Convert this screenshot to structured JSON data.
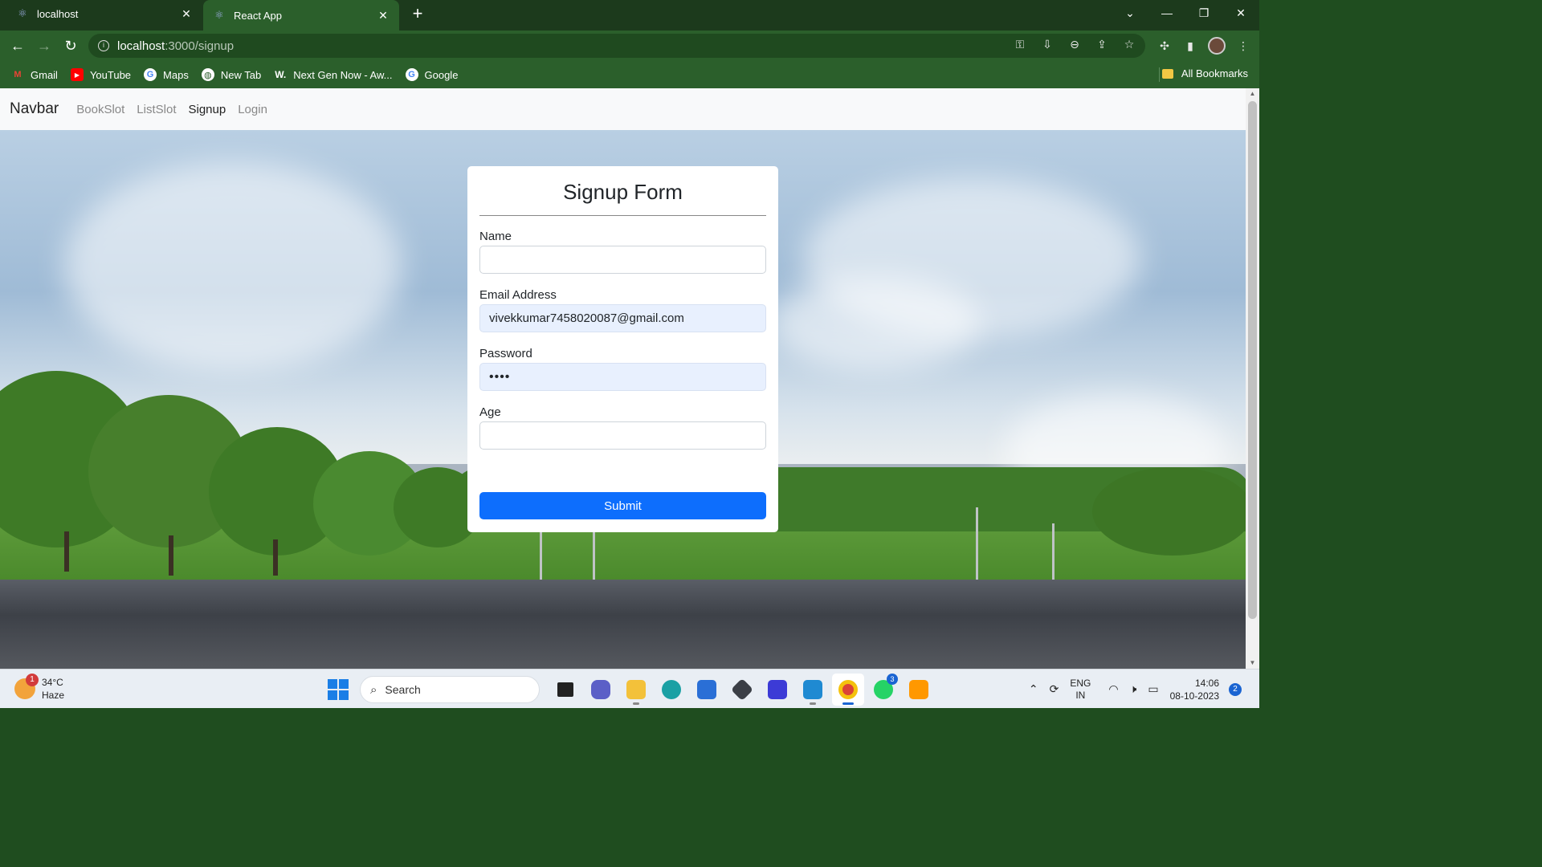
{
  "browser": {
    "tabs": [
      {
        "title": "localhost",
        "active": false
      },
      {
        "title": "React App",
        "active": true
      }
    ],
    "url_host": "localhost",
    "url_path": ":3000/signup",
    "bookmarks": [
      {
        "label": "Gmail",
        "icon": "gmail-icon",
        "color": "#ea4335"
      },
      {
        "label": "YouTube",
        "icon": "youtube-icon",
        "color": "#ff0000"
      },
      {
        "label": "Maps",
        "icon": "google-icon",
        "color": "#ffffff"
      },
      {
        "label": "New Tab",
        "icon": "globe-icon",
        "color": "#ffffff"
      },
      {
        "label": "Next Gen Now - Aw...",
        "icon": "w-icon",
        "color": "#222222"
      },
      {
        "label": "Google",
        "icon": "google-icon",
        "color": "#ffffff"
      }
    ],
    "all_bookmarks": "All Bookmarks"
  },
  "navbar": {
    "brand": "Navbar",
    "links": [
      {
        "label": "BookSlot",
        "active": false
      },
      {
        "label": "ListSlot",
        "active": false
      },
      {
        "label": "Signup",
        "active": true
      },
      {
        "label": "Login",
        "active": false
      }
    ]
  },
  "form": {
    "title": "Signup Form",
    "name_label": "Name",
    "name_value": "",
    "email_label": "Email Address",
    "email_value": "vivekkumar7458020087@gmail.com",
    "password_label": "Password",
    "password_value": "••••",
    "age_label": "Age",
    "age_value": "",
    "submit_label": "Submit",
    "accent_color": "#0d6efd"
  },
  "taskbar": {
    "weather_temp": "34°C",
    "weather_desc": "Haze",
    "weather_badge": "1",
    "search_label": "Search",
    "whatsapp_badge": "3",
    "lang_line1": "ENG",
    "lang_line2": "IN",
    "time": "14:06",
    "date": "08-10-2023",
    "notification_count": "2"
  }
}
